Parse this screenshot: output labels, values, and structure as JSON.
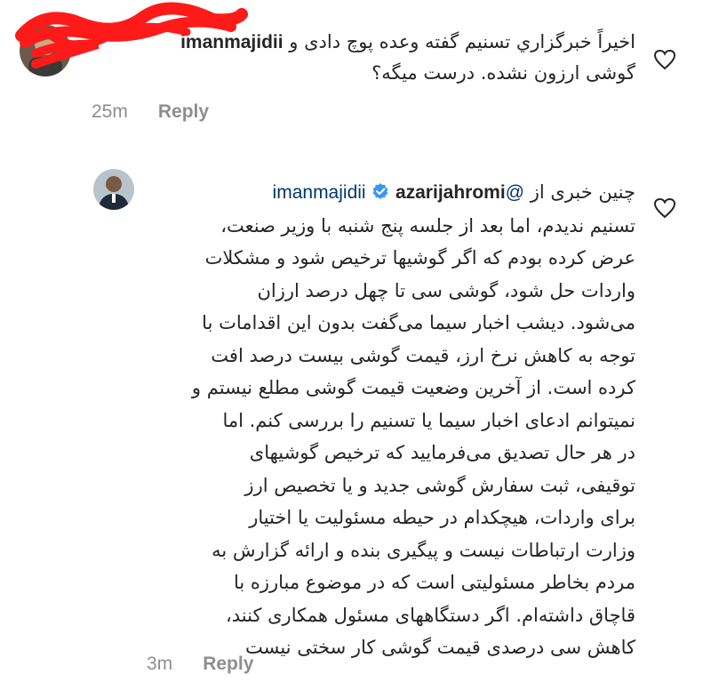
{
  "comment1": {
    "username": "imanmajidii",
    "text_line1": "اخیراً خبرگزاري تسنیم گفته وعده پوچ دادی و",
    "text_line2": "گوشی ارزون نشده. درست میگه؟",
    "time": "25m",
    "reply_label": "Reply"
  },
  "comment2": {
    "username": "azarijahromi",
    "mention": "@imanmajidii",
    "lines": [
      "چنین خبری از",
      "تسنیم ندیدم، اما بعد از جلسه پنج شنبه با وزیر صنعت،",
      "عرض کرده بودم که اگر گوشیها ترخیص شود و مشکلات",
      "واردات حل شود، گوشی سی تا چهل درصد ارزان",
      "می‌شود. دیشب اخبار سیما می‌گفت بدون این اقدامات با",
      "توجه به کاهش نرخ ارز، قیمت گوشی بیست درصد افت",
      "کرده است. از آخرین وضعیت قیمت گوشی مطلع نیستم و",
      "نمیتوانم ادعای اخبار سیما یا تسنیم را بررسی کنم. اما",
      "در هر حال تصدیق می‌فرمایید که ترخیص گوشیهای",
      "توقیفی، ثبت سفارش گوشی جدید و یا تخصیص ارز",
      "برای واردات، هیچکدام در حیطه مسئولیت یا اختیار",
      "وزارت ارتباطات نیست و پیگیری بنده و ارائه گزارش به",
      "مردم بخاطر مسئولیتی است که در موضوع مبارزه با",
      "قاچاق داشته‌ام. اگر دستگاههای مسئول همکاری کنند،",
      "کاهش سی درصدی قیمت گوشی کار سختی نیست"
    ],
    "time": "3m",
    "reply_label": "Reply"
  },
  "colors": {
    "text": "#262626",
    "meta": "#8e8e8e",
    "mention": "#00376b",
    "verified": "#3897f0",
    "scribble": "#ff1a1a"
  },
  "icons": [
    "heart-outline-icon",
    "verified-badge-icon",
    "avatar-image"
  ]
}
